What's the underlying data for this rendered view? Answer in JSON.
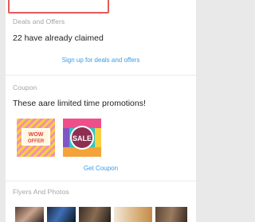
{
  "deals": {
    "heading": "Deals and Offers",
    "claimed_text": "22 have already claimed",
    "signup_link": "Sign up for deals and offers"
  },
  "coupons": {
    "heading": "Coupon",
    "description": "These aare limited time promotions!",
    "items": [
      {
        "line1": "WOW",
        "line2": "OFFER",
        "icon": "wow-offer-coupon-image"
      },
      {
        "line1": "SALE",
        "line2": "",
        "icon": "sale-coupon-image"
      }
    ],
    "get_link": "Get Coupon"
  },
  "photos": {
    "heading": "Flyers And Photos"
  },
  "colors": {
    "accent_link": "#3d9be0",
    "highlight_border": "#e35a5a"
  }
}
